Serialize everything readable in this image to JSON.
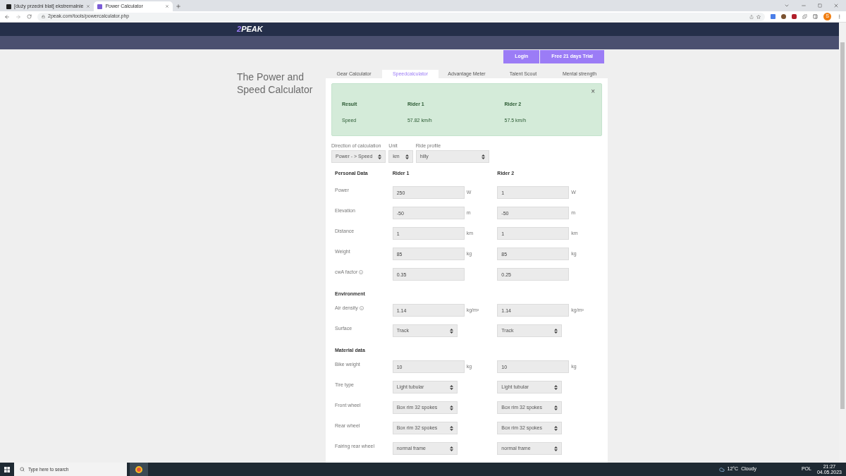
{
  "browser": {
    "tabs": [
      {
        "title": "[duży przedni blat] ekstremalnie",
        "selected": false
      },
      {
        "title": "Power Calculator",
        "selected": true
      }
    ],
    "url": "2peak.com/tools/powercalculator.php",
    "profile_initial": "S"
  },
  "site": {
    "logo": {
      "accent": "2",
      "text": "PEAK"
    },
    "buttons": [
      "Login",
      "Free 21 days Trial"
    ]
  },
  "page_title": "The Power and Speed Calculator",
  "tabs": [
    {
      "label": "Gear Calculator",
      "selected": false
    },
    {
      "label": "Speedcalculator",
      "selected": true
    },
    {
      "label": "Advantage Meter",
      "selected": false
    },
    {
      "label": "Talent Scout",
      "selected": false
    },
    {
      "label": "Mental strength",
      "selected": false
    }
  ],
  "result": {
    "close": "×",
    "columns": [
      "Result",
      "Rider 1",
      "Rider 2"
    ],
    "rows": [
      [
        "Speed",
        "57.82 km/h",
        "57.5 km/h"
      ]
    ]
  },
  "options": [
    {
      "label": "Direction of calculation",
      "value": "Power - > Speed"
    },
    {
      "label": "Unit",
      "value": "km"
    },
    {
      "label": "Ride profile",
      "value": "hilly"
    }
  ],
  "fields": [
    {
      "kind": "header",
      "label": "Personal Data",
      "columns": [
        "Rider 1",
        "Rider 2"
      ]
    },
    {
      "kind": "input",
      "label": "Power",
      "info": false,
      "riders": [
        {
          "value": "250",
          "unit": "W"
        },
        {
          "value": "1",
          "unit": "W"
        }
      ]
    },
    {
      "kind": "input",
      "label": "Elevation",
      "info": false,
      "riders": [
        {
          "value": "-50",
          "unit": "m"
        },
        {
          "value": "-50",
          "unit": "m"
        }
      ]
    },
    {
      "kind": "input",
      "label": "Distance",
      "info": false,
      "riders": [
        {
          "value": "1",
          "unit": "km"
        },
        {
          "value": "1",
          "unit": "km"
        }
      ]
    },
    {
      "kind": "input",
      "label": "Weight",
      "info": false,
      "riders": [
        {
          "value": "85",
          "unit": "kg"
        },
        {
          "value": "85",
          "unit": "kg"
        }
      ]
    },
    {
      "kind": "input",
      "label": "cwA factor",
      "info": true,
      "riders": [
        {
          "value": "0.35"
        },
        {
          "value": "0.25"
        }
      ]
    },
    {
      "kind": "section",
      "label": "Environment"
    },
    {
      "kind": "input",
      "label": "Air density",
      "info": true,
      "riders": [
        {
          "value": "1.14",
          "unit": "kg/m³"
        },
        {
          "value": "1.14",
          "unit": "kg/m³"
        }
      ]
    },
    {
      "kind": "select",
      "label": "Surface",
      "riders": [
        {
          "value": "Track"
        },
        {
          "value": "Track"
        }
      ]
    },
    {
      "kind": "section",
      "label": "Material data"
    },
    {
      "kind": "input",
      "label": "Bike weight",
      "info": false,
      "riders": [
        {
          "value": "10",
          "unit": "kg"
        },
        {
          "value": "10",
          "unit": "kg"
        }
      ]
    },
    {
      "kind": "select",
      "label": "Tire type",
      "riders": [
        {
          "value": "Light tubular"
        },
        {
          "value": "Light tubular"
        }
      ]
    },
    {
      "kind": "select",
      "label": "Front wheel",
      "riders": [
        {
          "value": "Box rim 32 spokes"
        },
        {
          "value": "Box rim 32 spokes"
        }
      ]
    },
    {
      "kind": "select",
      "label": "Rear wheel",
      "riders": [
        {
          "value": "Box rim 32 spokes"
        },
        {
          "value": "Box rim 32 spokes"
        }
      ]
    },
    {
      "kind": "select",
      "label": "Fairing rear wheel",
      "riders": [
        {
          "value": "normal frame"
        },
        {
          "value": "normal frame"
        }
      ]
    }
  ],
  "taskbar": {
    "search": "Type here to search",
    "temperature": "12°C",
    "weather": "Cloudy",
    "language": "POL",
    "time": "21:27",
    "date": "04.05.2023"
  }
}
